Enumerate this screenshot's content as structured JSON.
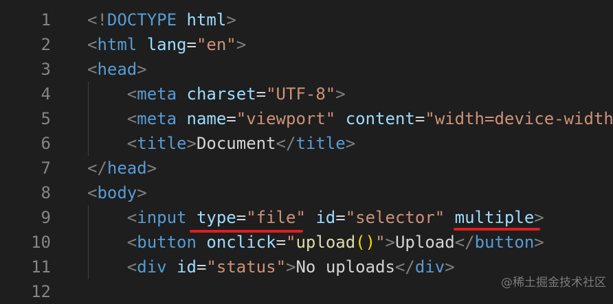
{
  "editor": {
    "lines": [
      {
        "number": "1",
        "indent": 0,
        "tokens": [
          [
            "bracket",
            "<!"
          ],
          [
            "tag",
            "DOCTYPE"
          ],
          [
            "text",
            " "
          ],
          [
            "attr",
            "html"
          ],
          [
            "bracket",
            ">"
          ]
        ]
      },
      {
        "number": "2",
        "indent": 0,
        "tokens": [
          [
            "bracket",
            "<"
          ],
          [
            "tag",
            "html"
          ],
          [
            "text",
            " "
          ],
          [
            "attr",
            "lang"
          ],
          [
            "eq",
            "="
          ],
          [
            "str",
            "\"en\""
          ],
          [
            "bracket",
            ">"
          ]
        ]
      },
      {
        "number": "3",
        "indent": 0,
        "tokens": [
          [
            "bracket",
            "<"
          ],
          [
            "tag",
            "head"
          ],
          [
            "bracket",
            ">"
          ]
        ]
      },
      {
        "number": "4",
        "indent": 1,
        "tokens": [
          [
            "bracket",
            "<"
          ],
          [
            "tag",
            "meta"
          ],
          [
            "text",
            " "
          ],
          [
            "attr",
            "charset"
          ],
          [
            "eq",
            "="
          ],
          [
            "str",
            "\"UTF-8\""
          ],
          [
            "bracket",
            ">"
          ]
        ]
      },
      {
        "number": "5",
        "indent": 1,
        "tokens": [
          [
            "bracket",
            "<"
          ],
          [
            "tag",
            "meta"
          ],
          [
            "text",
            " "
          ],
          [
            "attr",
            "name"
          ],
          [
            "eq",
            "="
          ],
          [
            "str",
            "\"viewport\""
          ],
          [
            "text",
            " "
          ],
          [
            "attr",
            "content"
          ],
          [
            "eq",
            "="
          ],
          [
            "str",
            "\"width=device-width"
          ]
        ]
      },
      {
        "number": "6",
        "indent": 1,
        "tokens": [
          [
            "bracket",
            "<"
          ],
          [
            "tag",
            "title"
          ],
          [
            "bracket",
            ">"
          ],
          [
            "text",
            "Document"
          ],
          [
            "bracket",
            "</"
          ],
          [
            "tag",
            "title"
          ],
          [
            "bracket",
            ">"
          ]
        ]
      },
      {
        "number": "7",
        "indent": 0,
        "tokens": [
          [
            "bracket",
            "</"
          ],
          [
            "tag",
            "head"
          ],
          [
            "bracket",
            ">"
          ]
        ]
      },
      {
        "number": "8",
        "indent": 0,
        "tokens": [
          [
            "bracket",
            "<"
          ],
          [
            "tag",
            "body"
          ],
          [
            "bracket",
            ">"
          ]
        ]
      },
      {
        "number": "9",
        "indent": 1,
        "tokens": [
          [
            "bracket",
            "<"
          ],
          [
            "tag",
            "input"
          ],
          [
            "text",
            " "
          ],
          [
            "attr",
            "type"
          ],
          [
            "eq",
            "="
          ],
          [
            "str",
            "\"file\""
          ],
          [
            "text",
            " "
          ],
          [
            "attr",
            "id"
          ],
          [
            "eq",
            "="
          ],
          [
            "str",
            "\"selector\""
          ],
          [
            "text",
            " "
          ],
          [
            "attr",
            "multiple"
          ],
          [
            "bracket",
            ">"
          ]
        ]
      },
      {
        "number": "10",
        "indent": 1,
        "tokens": [
          [
            "bracket",
            "<"
          ],
          [
            "tag",
            "button"
          ],
          [
            "text",
            " "
          ],
          [
            "attr",
            "onclick"
          ],
          [
            "eq",
            "="
          ],
          [
            "str",
            "\""
          ],
          [
            "fn",
            "upload"
          ],
          [
            "paren",
            "()"
          ],
          [
            "str",
            "\""
          ],
          [
            "bracket",
            ">"
          ],
          [
            "text",
            "Upload"
          ],
          [
            "bracket",
            "</"
          ],
          [
            "tag",
            "button"
          ],
          [
            "bracket",
            ">"
          ]
        ]
      },
      {
        "number": "11",
        "indent": 1,
        "tokens": [
          [
            "bracket",
            "<"
          ],
          [
            "tag",
            "div"
          ],
          [
            "text",
            " "
          ],
          [
            "attr",
            "id"
          ],
          [
            "eq",
            "="
          ],
          [
            "str",
            "\"status\""
          ],
          [
            "bracket",
            ">"
          ],
          [
            "text",
            "No uploads"
          ],
          [
            "bracket",
            "</"
          ],
          [
            "tag",
            "div"
          ],
          [
            "bracket",
            ">"
          ]
        ]
      },
      {
        "number": "12",
        "indent": 0,
        "tokens": []
      }
    ]
  },
  "annotation_color": "#e51c1c",
  "watermark": "@稀土掘金技术社区"
}
